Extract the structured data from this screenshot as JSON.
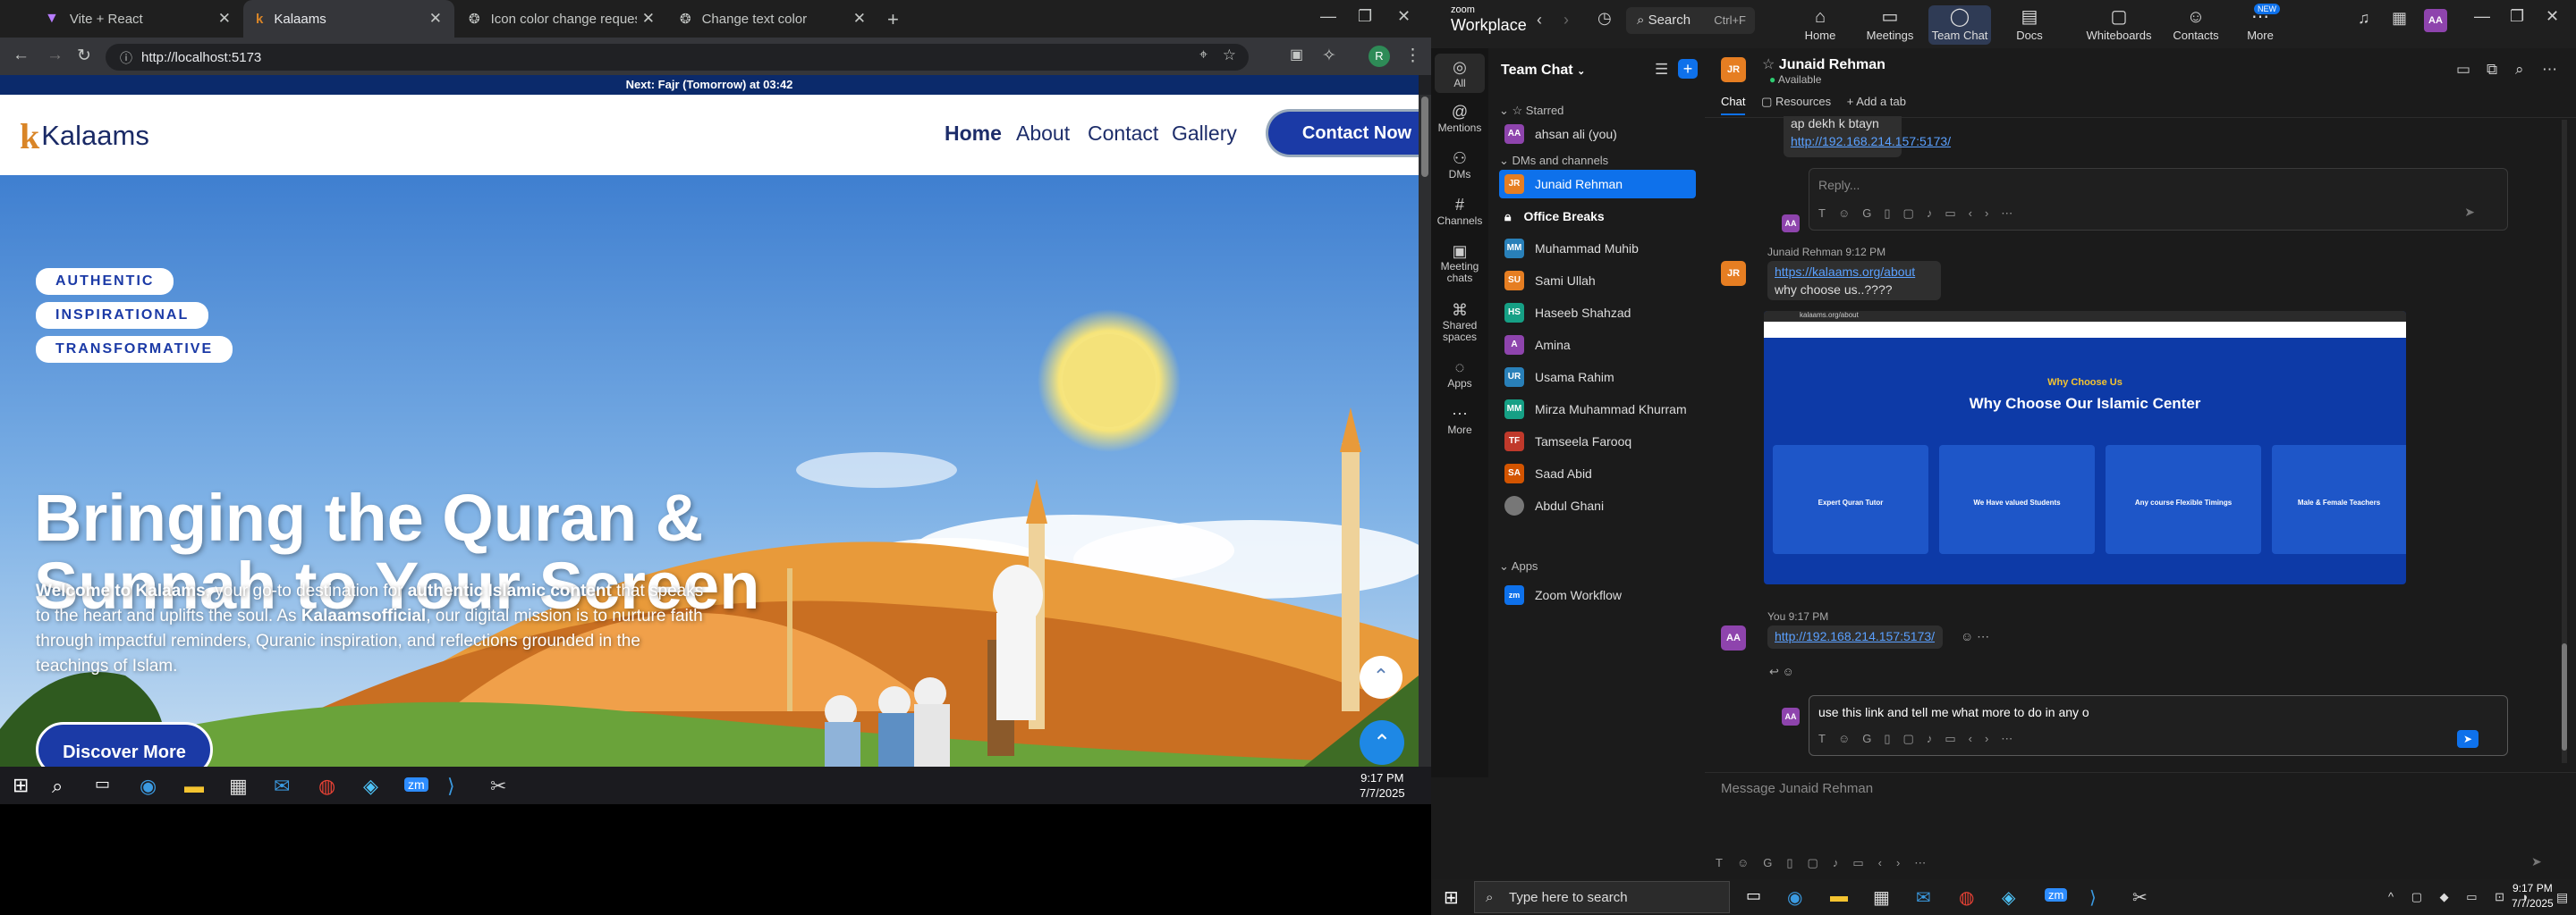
{
  "chrome": {
    "tabs": [
      {
        "label": "Vite + React",
        "icon": "vite-icon"
      },
      {
        "label": "Kalaams",
        "icon": "kalaams-favicon"
      },
      {
        "label": "Icon color change request",
        "icon": "chatgpt-icon"
      },
      {
        "label": "Change text color",
        "icon": "chatgpt-icon"
      }
    ],
    "url": "http://localhost:5173"
  },
  "site": {
    "prayer_bar": "Next: Fajr (Tomorrow) at 03:42",
    "logo_k": "k",
    "logo_text": "Kalaams",
    "nav": [
      "Home",
      "About",
      "Contact",
      "Gallery"
    ],
    "contact_button": "Contact Now",
    "pills": [
      "AUTHENTIC",
      "INSPIRATIONAL",
      "TRANSFORMATIVE"
    ],
    "hero_title_1": "Bringing the Quran &",
    "hero_title_2": "Sunnah to Your Screen",
    "hero_para": {
      "p1": "Welcome to Kalaams",
      "p2": ", your go-to destination for ",
      "p3": "authentic Islamic content",
      "p4": " that speaks to the heart and uplifts the soul. As ",
      "p5": "Kalaamsofficial",
      "p6": ", our digital mission is to nurture faith through impactful reminders, Quranic inspiration, and reflections grounded in the teachings of Islam."
    },
    "discover_button": "Discover More"
  },
  "taskbar_left": {
    "time": "9:17 PM",
    "date": "7/7/2025"
  },
  "zoom": {
    "brand_small": "zoom",
    "brand": "Workplace",
    "search": "Search",
    "search_shortcut": "Ctrl+F",
    "top_tabs": [
      "Home",
      "Meetings",
      "Team Chat",
      "Docs",
      "Whiteboards",
      "Contacts",
      "More"
    ],
    "new_badge": "NEW",
    "user_initials": "AA",
    "rail": [
      "All",
      "Mentions",
      "DMs",
      "Channels",
      "Meeting chats",
      "Shared spaces",
      "Apps",
      "More"
    ],
    "panel_title": "Team Chat",
    "sections": {
      "starred": "Starred",
      "dms": "DMs and channels",
      "apps": "Apps"
    },
    "starred": [
      {
        "initials": "AA",
        "name": "ahsan ali (you)",
        "color": "#8e44ad"
      }
    ],
    "contacts": [
      {
        "initials": "JR",
        "name": "Junaid Rehman",
        "color": "#e67e22",
        "selected": true
      },
      {
        "initials": "",
        "name": "Office Breaks",
        "color": "",
        "bold": true
      },
      {
        "initials": "MM",
        "name": "Muhammad Muhib",
        "color": "#2980b9"
      },
      {
        "initials": "SU",
        "name": "Sami Ullah",
        "color": "#e67e22"
      },
      {
        "initials": "HS",
        "name": "Haseeb Shahzad",
        "color": "#16a085"
      },
      {
        "initials": "A",
        "name": "Amina",
        "color": "#8e44ad"
      },
      {
        "initials": "UR",
        "name": "Usama Rahim",
        "color": "#2980b9"
      },
      {
        "initials": "MM",
        "name": "Mirza Muhammad Khurram",
        "color": "#16a085"
      },
      {
        "initials": "TF",
        "name": "Tamseela Farooq",
        "color": "#c0392b"
      },
      {
        "initials": "SA",
        "name": "Saad Abid",
        "color": "#d35400"
      },
      {
        "initials": "",
        "name": "Abdul Ghani",
        "color": "#777"
      }
    ],
    "apps": [
      {
        "name": "Zoom Workflow"
      }
    ],
    "chat": {
      "name": "Junaid Rehman",
      "initials": "JR",
      "status": "Available",
      "tabs": [
        "Chat",
        "Resources",
        "Add a tab"
      ],
      "top_msg": "ap dekh k btayn",
      "top_link": "http://192.168.214.157:5173/",
      "reply_placeholder": "Reply...",
      "msg2_author": "Junaid Rehman",
      "msg2_time": "9:12 PM",
      "msg2_link": "https://kalaams.org/about",
      "msg2_text": "why choose us..????",
      "shot": {
        "url": "kalaams.org/about",
        "kicker": "Why Choose Us",
        "title": "Why Choose Our Islamic Center",
        "cards": [
          "Expert Quran Tutor",
          "We Have valued Students",
          "Any course Flexible Timings",
          "Male & Female Teachers"
        ]
      },
      "msg3_author": "You",
      "msg3_time": "9:17 PM",
      "msg3_link": "http://192.168.214.157:5173/",
      "draft": "use this link and tell me what more to do in any o",
      "composer_placeholder": "Message Junaid Rehman"
    }
  },
  "taskbar_right": {
    "search": "Type here to search",
    "time": "9:17 PM",
    "date": "7/7/2025"
  }
}
